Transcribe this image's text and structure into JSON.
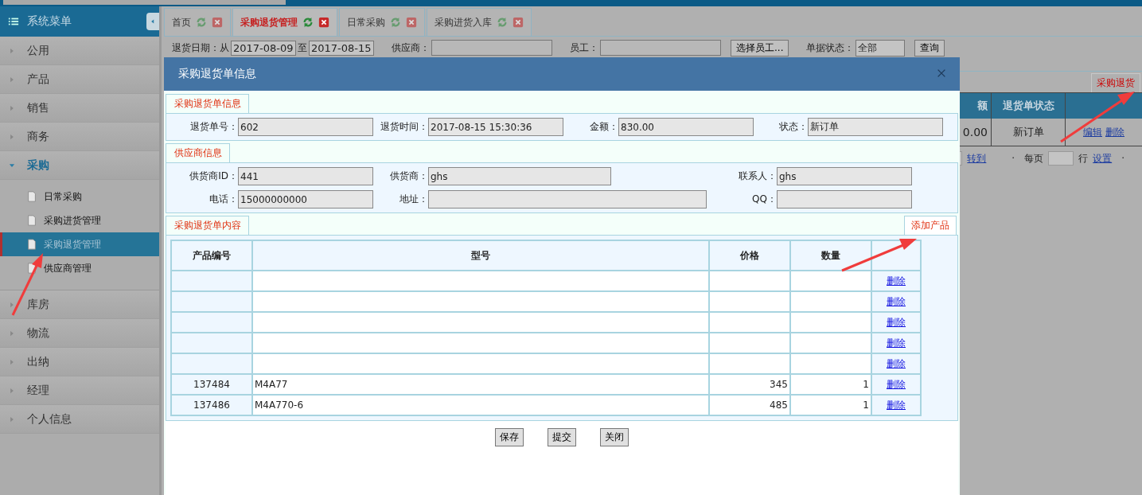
{
  "sidebar": {
    "title": "系统菜单",
    "items": [
      {
        "label": "公用",
        "expanded": false
      },
      {
        "label": "产品",
        "expanded": false
      },
      {
        "label": "销售",
        "expanded": false
      },
      {
        "label": "商务",
        "expanded": false
      },
      {
        "label": "采购",
        "expanded": true,
        "children": [
          {
            "label": "日常采购",
            "selected": false
          },
          {
            "label": "采购进货管理",
            "selected": false
          },
          {
            "label": "采购退货管理",
            "selected": true
          },
          {
            "label": "供应商管理",
            "selected": false
          }
        ]
      },
      {
        "label": "库房",
        "expanded": false
      },
      {
        "label": "物流",
        "expanded": false
      },
      {
        "label": "出纳",
        "expanded": false
      },
      {
        "label": "经理",
        "expanded": false
      },
      {
        "label": "个人信息",
        "expanded": false
      }
    ]
  },
  "tabs": [
    {
      "label": "首页",
      "selected": false
    },
    {
      "label": "采购退货管理",
      "selected": true
    },
    {
      "label": "日常采购",
      "selected": false
    },
    {
      "label": "采购进货入库",
      "selected": false
    }
  ],
  "filter_bar": {
    "date_label": "退货日期：从",
    "date_from": "2017-08-09",
    "date_to_label": "至",
    "date_to": "2017-08-15",
    "supplier_label": "供应商：",
    "employee_label": "员工：",
    "choose_employee_button": "选择员工...",
    "status_label": "单据状态：",
    "status_value": "全部",
    "query_button": "查询"
  },
  "list_panel": {
    "tab": "采购退货",
    "columns": [
      "额",
      "退货单状态"
    ],
    "rows": [
      {
        "amount": "0.00",
        "status": "新订单",
        "actions": [
          "编辑",
          "删除"
        ]
      }
    ],
    "pager": {
      "goto": "转到",
      "leading_dot": "·",
      "per_page_label": "每页",
      "rows_label": "行",
      "settings": "设置",
      "trailing_dot": "·"
    }
  },
  "dialog": {
    "title": "采购退货单信息",
    "order_info": {
      "title": "采购退货单信息",
      "fields": [
        {
          "label": "退货单号：",
          "value": "602"
        },
        {
          "label": "退货时间：",
          "value": "2017-08-15 15:30:36"
        },
        {
          "label": "金额：",
          "value": "830.00"
        },
        {
          "label": "状态：",
          "value": "新订单"
        }
      ]
    },
    "supplier_info": {
      "title": "供应商信息",
      "fields": [
        {
          "label": "供货商ID：",
          "value": "441"
        },
        {
          "label": "供货商：",
          "value": "ghs"
        },
        {
          "label": "联系人：",
          "value": "ghs"
        },
        {
          "label": "电话：",
          "value": "15000000000"
        },
        {
          "label": "地址："
        },
        {
          "label": "QQ："
        }
      ]
    },
    "content": {
      "title": "采购退货单内容",
      "add_button": "添加产品",
      "columns": [
        "产品编号",
        "型号",
        "价格",
        "数量"
      ],
      "rows": [
        {
          "action": "删除"
        },
        {
          "action": "删除"
        },
        {
          "action": "删除"
        },
        {
          "action": "删除"
        },
        {
          "action": "删除"
        },
        {
          "code": "137484",
          "model": "M4A77",
          "price": "345",
          "quantity": "1",
          "action": "删除"
        },
        {
          "code": "137486",
          "model": "M4A770-6",
          "price": "485",
          "quantity": "1",
          "action": "删除"
        }
      ]
    },
    "buttons": [
      "保存",
      "提交",
      "关闭"
    ]
  }
}
